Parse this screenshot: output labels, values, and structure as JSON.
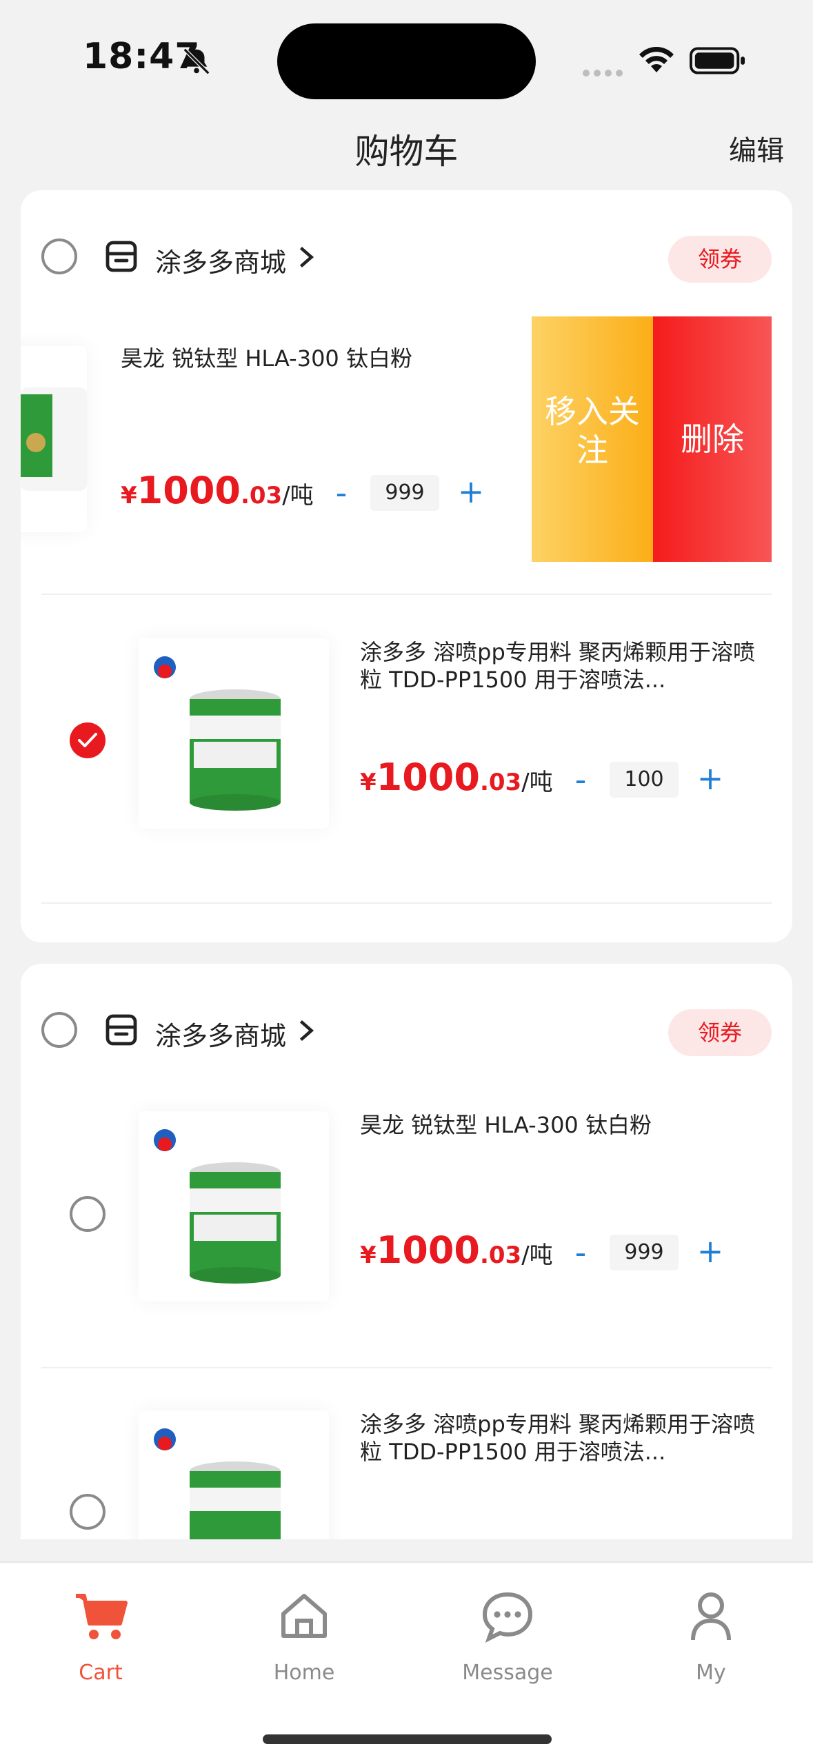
{
  "status": {
    "time": "18:47"
  },
  "nav": {
    "title": "购物车",
    "edit": "编辑"
  },
  "colors": {
    "accent": "#e8191f",
    "tab_active": "#f0533a",
    "link_blue": "#1e7fd6"
  },
  "groups": [
    {
      "shop_name": "涂多多商城",
      "coupon": "领券",
      "selected": false,
      "items": [
        {
          "title": "昊龙 锐钛型 HLA-300 钛白粉",
          "currency": "¥",
          "price_int": "1000",
          "price_dec": ".03",
          "unit": "/吨",
          "minus": "-",
          "quantity": "999",
          "plus": "+",
          "selected": false,
          "swipe_actions": {
            "follow": "移入关注",
            "delete": "删除"
          }
        },
        {
          "title": "涂多多 溶喷pp专用料 聚丙烯颗用于溶喷粒 TDD-PP1500 用于溶喷法...",
          "currency": "¥",
          "price_int": "1000",
          "price_dec": ".03",
          "unit": "/吨",
          "minus": "-",
          "quantity": "100",
          "plus": "+",
          "selected": true
        }
      ]
    },
    {
      "shop_name": "涂多多商城",
      "coupon": "领券",
      "selected": false,
      "items": [
        {
          "title": "昊龙 锐钛型 HLA-300 钛白粉",
          "currency": "¥",
          "price_int": "1000",
          "price_dec": ".03",
          "unit": "/吨",
          "minus": "-",
          "quantity": "999",
          "plus": "+",
          "selected": false
        },
        {
          "title": "涂多多 溶喷pp专用料 聚丙烯颗用于溶喷粒 TDD-PP1500 用于溶喷法...",
          "selected": false
        }
      ]
    }
  ],
  "tabs": [
    {
      "label": "Cart",
      "icon": "cart-icon",
      "active": true
    },
    {
      "label": "Home",
      "icon": "home-icon",
      "active": false
    },
    {
      "label": "Message",
      "icon": "message-icon",
      "active": false
    },
    {
      "label": "My",
      "icon": "user-icon",
      "active": false
    }
  ]
}
